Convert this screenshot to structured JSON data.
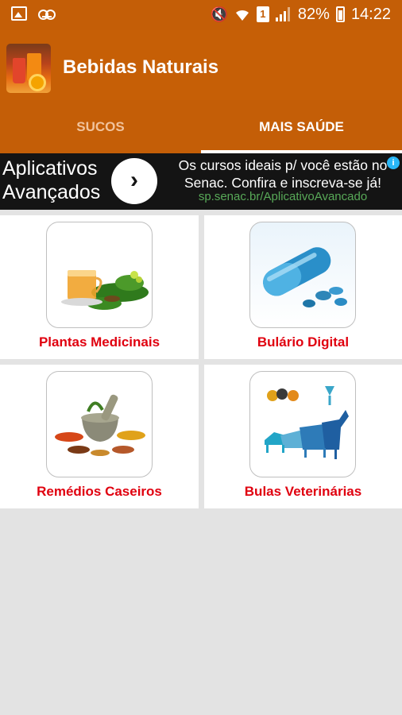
{
  "status_bar": {
    "battery": "82%",
    "time": "14:22",
    "sim_slot": "1",
    "icons": [
      "gallery-icon",
      "voicemail-icon",
      "mute-icon",
      "wifi-icon",
      "sim-icon",
      "signal-icon",
      "battery-icon"
    ]
  },
  "app_bar": {
    "title": "Bebidas Naturais"
  },
  "tabs": [
    {
      "label": "SUCOS",
      "selected": false
    },
    {
      "label": "MAIS SAÚDE",
      "selected": true
    }
  ],
  "ad": {
    "headline_line1": "Aplicativos",
    "headline_line2": "Avançados",
    "text_line1": "Os cursos ideais p/ você estão no",
    "text_line2": "Senac. Confira e inscreva-se já!",
    "url": "sp.senac.br/AplicativoAvancado"
  },
  "grid": [
    {
      "label": "Plantas Medicinais"
    },
    {
      "label": "Bulário Digital"
    },
    {
      "label": "Remédios Caseiros"
    },
    {
      "label": "Bulas Veterinárias"
    }
  ],
  "colors": {
    "app_bar": "#c65f06",
    "status_bar": "#c45e07",
    "label_red": "#e0000f",
    "background": "#e3e3e3"
  }
}
